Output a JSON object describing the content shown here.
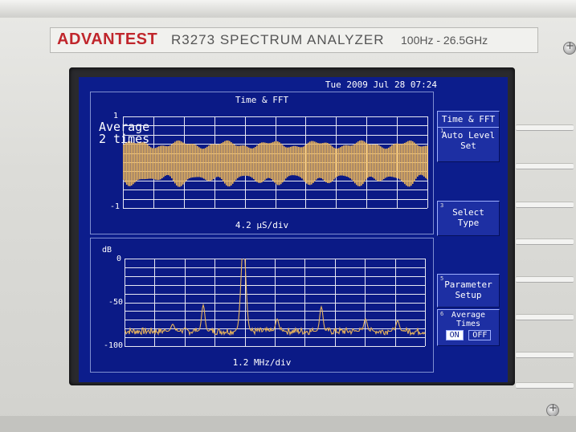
{
  "device": {
    "brand": "ADVANTEST",
    "model": "R3273 SPECTRUM ANALYZER",
    "freq_range": "100Hz - 26.5GHz"
  },
  "screen": {
    "datetime": "Tue 2009 Jul 28 07:24",
    "top_panel": {
      "title": "Time & FFT",
      "overlay_line1": "Average",
      "overlay_line2": "2 times",
      "y_top": "1",
      "y_bottom": "-1",
      "x_scale": "4.2 µS/div"
    },
    "bottom_panel": {
      "y_unit": "dB",
      "y_top": "0",
      "y_mid": "-50",
      "y_bottom": "-100",
      "x_scale": "1.2 MHz/div"
    },
    "softkeys": [
      {
        "num": "",
        "line1": "Time & FFT",
        "line2": ""
      },
      {
        "num": "1",
        "line1": "Auto Level",
        "line2": "Set"
      },
      {
        "num": "3",
        "line1": "Select",
        "line2": "Type"
      },
      {
        "num": "5",
        "line1": "Parameter",
        "line2": "Setup"
      },
      {
        "num": "6",
        "line1": "Average",
        "line2": "Times",
        "on": "ON",
        "off": "OFF"
      }
    ]
  },
  "colors": {
    "screen_bg": "#0c1d8c",
    "trace": "#e8b45c",
    "grid": "#ffffff",
    "brand": "#c0262c"
  }
}
